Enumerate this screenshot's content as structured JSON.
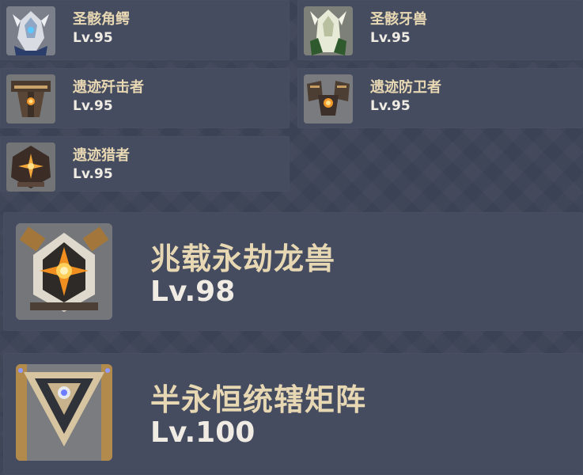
{
  "enemies": [
    {
      "name": "圣骸角鳄",
      "level": "Lv.95",
      "icon": "sacred-hornback-icon"
    },
    {
      "name": "圣骸牙兽",
      "level": "Lv.95",
      "icon": "sacred-fangbeast-icon"
    },
    {
      "name": "遗迹歼击者",
      "level": "Lv.95",
      "icon": "ruin-destroyer-icon"
    },
    {
      "name": "遗迹防卫者",
      "level": "Lv.95",
      "icon": "ruin-defender-icon"
    },
    {
      "name": "遗迹猎者",
      "level": "Lv.95",
      "icon": "ruin-hunter-icon"
    }
  ],
  "bosses": [
    {
      "name": "兆载永劫龙兽",
      "level": "Lv.98",
      "icon": "aeonblight-drake-icon"
    },
    {
      "name": "半永恒统辖矩阵",
      "level": "Lv.100",
      "icon": "perpetual-mechanical-array-icon"
    }
  ]
}
